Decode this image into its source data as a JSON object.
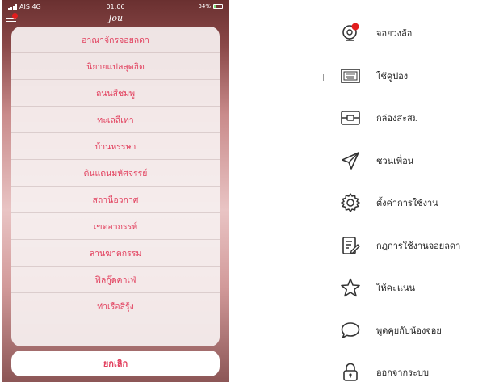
{
  "status_bar": {
    "carrier": "AIS 4G",
    "time": "01:06",
    "battery": "34%"
  },
  "header": {
    "logo_text": "Jou"
  },
  "action_sheet": {
    "items": [
      "อาณาจักรจอยลดา",
      "นิยายแปลสุดฮิต",
      "ถนนสีชมพู",
      "ทะเลสีเทา",
      "บ้านหรรษา",
      "ดินแดนมหัศจรรย์",
      "สถานีอวกาศ",
      "เขตอาถรรพ์",
      "ลานฆาตกรรม",
      "ฟิลกู๊ดคาเฟ่",
      "ท่าเรือสีรุ้ง"
    ],
    "cancel_label": "ยกเลิก"
  },
  "side_menu": {
    "items": [
      {
        "label": "จอยวงล้อ",
        "icon": "spin-wheel-icon"
      },
      {
        "label": "ใช้คูปอง",
        "icon": "coupon-icon"
      },
      {
        "label": "กล่องสะสม",
        "icon": "collection-box-icon"
      },
      {
        "label": "ชวนเพื่อน",
        "icon": "paper-plane-icon"
      },
      {
        "label": "ตั้งค่าการใช้งาน",
        "icon": "gear-icon"
      },
      {
        "label": "กฎการใช้งานจอยลดา",
        "icon": "rules-document-icon"
      },
      {
        "label": "ให้คะแนน",
        "icon": "star-icon"
      },
      {
        "label": "พูดคุยกับน้องจอย",
        "icon": "chat-bubble-icon"
      },
      {
        "label": "ออกจากระบบ",
        "icon": "lock-icon"
      }
    ]
  },
  "colors": {
    "accent": "#e2405e",
    "notification_dot": "#e21d1d"
  }
}
